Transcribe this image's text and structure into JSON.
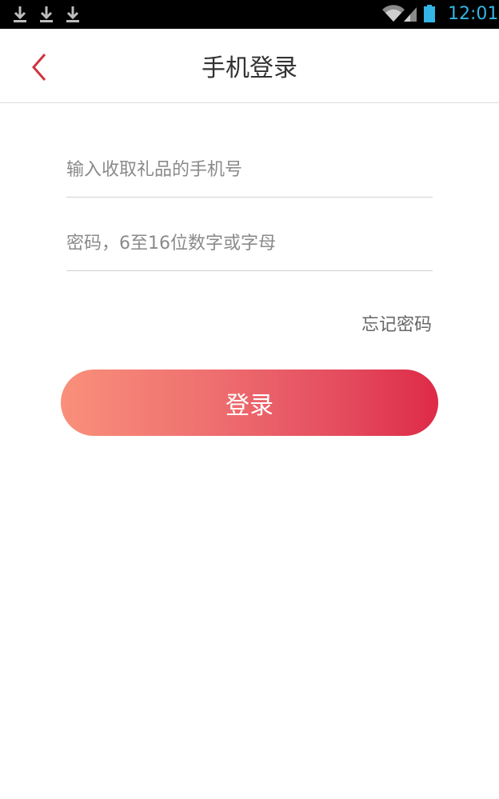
{
  "status_bar": {
    "time": "12:01",
    "icons": [
      "download-icon",
      "download-icon",
      "download-icon",
      "wifi-icon",
      "signal-icon",
      "battery-icon"
    ],
    "clock_color": "#33b5e5"
  },
  "nav": {
    "title": "手机登录",
    "back_icon": "chevron-left-icon",
    "back_color": "#d0343f"
  },
  "form": {
    "phone_placeholder": "输入收取礼品的手机号",
    "phone_value": "",
    "password_placeholder": "密码，6至16位数字或字母",
    "password_value": "",
    "forgot_label": "忘记密码",
    "login_label": "登录"
  },
  "colors": {
    "button_gradient_start": "#f9907a",
    "button_gradient_end": "#de2a48"
  }
}
